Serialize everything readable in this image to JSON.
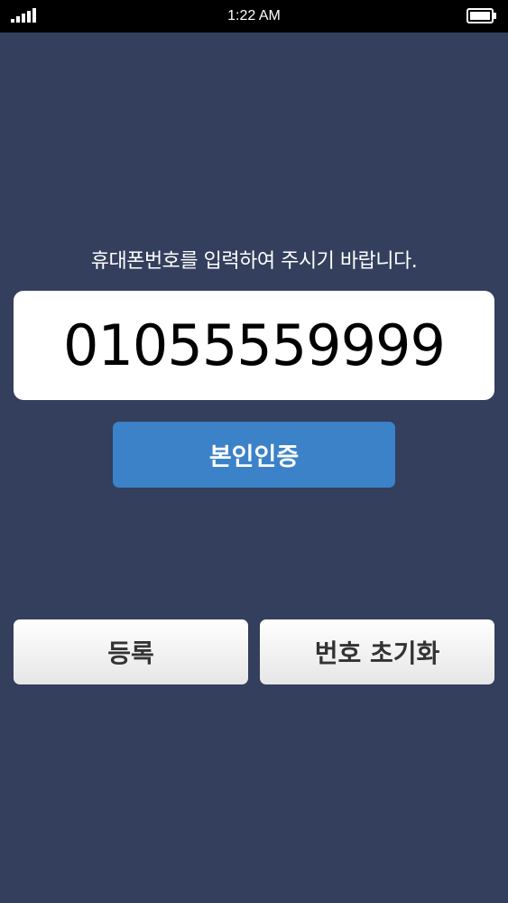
{
  "status_bar": {
    "time": "1:22 AM",
    "signal_icon": "signal-bars-icon",
    "battery_icon": "battery-icon"
  },
  "instruction": "휴대폰번호를 입력하여 주시기 바랍니다.",
  "phone_input": {
    "value": "01055559999"
  },
  "buttons": {
    "verify_label": "본인인증",
    "register_label": "등록",
    "reset_label": "번호 초기화"
  },
  "colors": {
    "background": "#333f5d",
    "verify_button": "#3b82c9"
  }
}
